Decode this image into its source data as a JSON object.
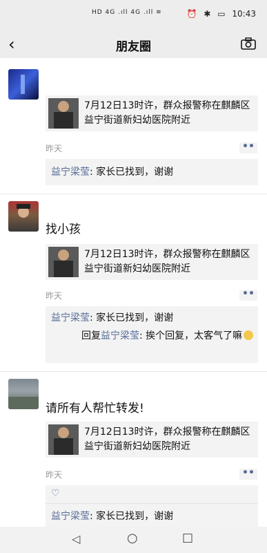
{
  "status_bar": {
    "left_indicators": "HD 4G .ıll 4G .ıll ≋",
    "alarm_icon": "alarm-icon",
    "bluetooth_icon": "bluetooth-icon",
    "battery_icon": "battery-icon",
    "time": "10:43"
  },
  "nav": {
    "title": "朋友圈"
  },
  "shared_article": "7月12日13时许，群众报警称在麒麟区益宁街道新妇幼医院附近",
  "posts": [
    {
      "nickname": "",
      "text": "",
      "time": "昨天",
      "comments": [
        {
          "name": "益宁梁莹",
          "sep": ": ",
          "text": "家长已找到，谢谢"
        }
      ]
    },
    {
      "nickname": "",
      "text": "找小孩",
      "time": "昨天",
      "comments": [
        {
          "name": "益宁梁莹",
          "sep": ": ",
          "text": "家长已找到，谢谢"
        },
        {
          "prefix": "回复",
          "name": "益宁梁莹",
          "sep": ": ",
          "text": "挨个回复，太客气了嘛"
        }
      ]
    },
    {
      "nickname": "",
      "text": "请所有人帮忙转发!",
      "time": "昨天",
      "comments": [
        {
          "name": "益宁梁莹",
          "sep": ": ",
          "text": "家长已找到，谢谢"
        }
      ]
    }
  ],
  "more_glyph": "••",
  "like_glyph": "♡",
  "bottom_nav": {
    "back_glyph": "◁",
    "home_glyph": "○",
    "recent_glyph": "□"
  }
}
